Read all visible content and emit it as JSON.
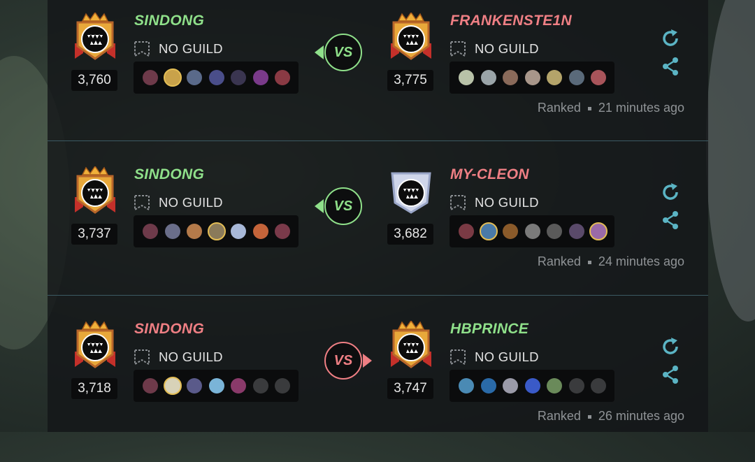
{
  "colors": {
    "win": "#8fe08a",
    "lose": "#ef7f84",
    "accent": "#5bb4c4",
    "gold": "#e3bd55"
  },
  "battles": [
    {
      "vs_label": "VS",
      "vs_direction": "left",
      "left": {
        "name": "SINDONG",
        "result": "win",
        "guild": "NO GUILD",
        "rating": "3,760",
        "league": "gold",
        "units": [
          {
            "color": "#6e3a4a",
            "gold": false
          },
          {
            "color": "#c9a24a",
            "gold": true
          },
          {
            "color": "#5a6a8a",
            "gold": false
          },
          {
            "color": "#4a4e8a",
            "gold": false
          },
          {
            "color": "#3a3550",
            "gold": false
          },
          {
            "color": "#7a3a8a",
            "gold": false
          },
          {
            "color": "#8a3a44",
            "gold": false
          }
        ]
      },
      "right": {
        "name": "FRANKENSTE1N",
        "result": "lose",
        "guild": "NO GUILD",
        "rating": "3,775",
        "league": "gold",
        "units": [
          {
            "color": "#b8c2a8",
            "gold": false
          },
          {
            "color": "#9aa4a8",
            "gold": false
          },
          {
            "color": "#8a6a5a",
            "gold": false
          },
          {
            "color": "#a8968a",
            "gold": false
          },
          {
            "color": "#b4a46a",
            "gold": false
          },
          {
            "color": "#5a6a7a",
            "gold": false
          },
          {
            "color": "#a8545a",
            "gold": false
          }
        ]
      },
      "mode": "Ranked",
      "time": "21 minutes ago"
    },
    {
      "vs_label": "VS",
      "vs_direction": "left",
      "left": {
        "name": "SINDONG",
        "result": "win",
        "guild": "NO GUILD",
        "rating": "3,737",
        "league": "gold",
        "units": [
          {
            "color": "#6e3a4a",
            "gold": false
          },
          {
            "color": "#6a6e8a",
            "gold": false
          },
          {
            "color": "#b47a4a",
            "gold": false
          },
          {
            "color": "#8a7a5a",
            "gold": true
          },
          {
            "color": "#a8b8d8",
            "gold": false
          },
          {
            "color": "#c4643a",
            "gold": false
          },
          {
            "color": "#7a3a4a",
            "gold": false
          }
        ]
      },
      "right": {
        "name": "MY-CLEON",
        "result": "lose",
        "guild": "NO GUILD",
        "rating": "3,682",
        "league": "diamond",
        "units": [
          {
            "color": "#7a3a44",
            "gold": false
          },
          {
            "color": "#4a7aa8",
            "gold": true
          },
          {
            "color": "#8a5a2a",
            "gold": false
          },
          {
            "color": "#7a7a7a",
            "gold": false
          },
          {
            "color": "#5a5a5a",
            "gold": false
          },
          {
            "color": "#5a4a6a",
            "gold": false
          },
          {
            "color": "#9a6aa8",
            "gold": true
          }
        ]
      },
      "mode": "Ranked",
      "time": "24 minutes ago"
    },
    {
      "vs_label": "VS",
      "vs_direction": "right",
      "left": {
        "name": "SINDONG",
        "result": "lose",
        "guild": "NO GUILD",
        "rating": "3,718",
        "league": "gold",
        "units": [
          {
            "color": "#6e3a4a",
            "gold": false
          },
          {
            "color": "#d8d2b8",
            "gold": true
          },
          {
            "color": "#5a5a8a",
            "gold": false
          },
          {
            "color": "#7ab4d8",
            "gold": false
          },
          {
            "color": "#8a3a6a",
            "gold": false
          },
          {
            "color": "",
            "gold": false,
            "empty": true
          },
          {
            "color": "",
            "gold": false,
            "empty": true
          }
        ]
      },
      "right": {
        "name": "HBPRINCE",
        "result": "win",
        "guild": "NO GUILD",
        "rating": "3,747",
        "league": "gold",
        "units": [
          {
            "color": "#4a8ab4",
            "gold": false
          },
          {
            "color": "#2a6aa8",
            "gold": false
          },
          {
            "color": "#9a9aa8",
            "gold": false
          },
          {
            "color": "#3a5ac8",
            "gold": false
          },
          {
            "color": "#6a8a5a",
            "gold": false
          },
          {
            "color": "",
            "gold": false,
            "empty": true
          },
          {
            "color": "",
            "gold": false,
            "empty": true
          }
        ]
      },
      "mode": "Ranked",
      "time": "26 minutes ago"
    }
  ]
}
